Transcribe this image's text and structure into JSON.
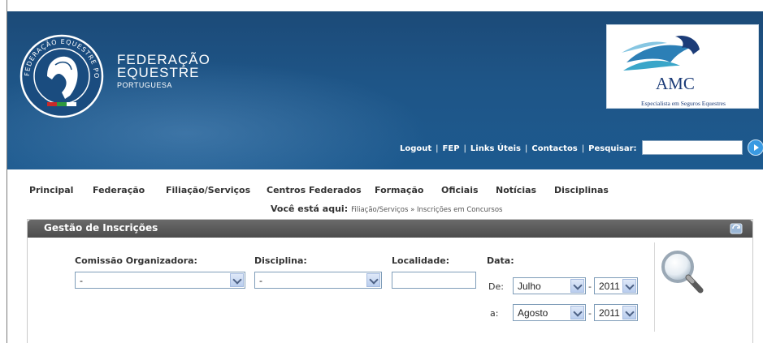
{
  "header": {
    "logo_line1": "FEDERAÇÃO",
    "logo_line2": "EQUESTRE",
    "logo_line3": "PORTUGUESA",
    "seal_text": "FEDERAÇÃO EQUESTRE PORTUGUESA",
    "sponsor_name": "AMC",
    "sponsor_tagline": "Especialista em Seguros Equestres",
    "top_links": [
      "Logout",
      "FEP",
      "Links Úteis",
      "Contactos"
    ],
    "search_label": "Pesquisar:",
    "search_value": ""
  },
  "nav": {
    "items": [
      "Principal",
      "Federação",
      "Filiação/Serviços",
      "Centros Federados",
      "Formação",
      "Oficiais",
      "Notícias",
      "Disciplinas"
    ]
  },
  "breadcrumb": {
    "label": "Você está aqui:",
    "path": "Filiação/Serviços » Inscrições em Concursos"
  },
  "panel": {
    "title": "Gestão de Inscrições",
    "fields": {
      "comissao_label": "Comissão Organizadora:",
      "comissao_value": "-",
      "disciplina_label": "Disciplina:",
      "disciplina_value": "-",
      "localidade_label": "Localidade:",
      "localidade_value": "",
      "data_label": "Data:",
      "de_label": "De:",
      "de_month": "Julho",
      "de_year": "2011",
      "a_label": "a:",
      "a_month": "Agosto",
      "a_year": "2011",
      "dash": "-"
    }
  },
  "colors": {
    "header_blue": "#1e5587",
    "panel_header": "#555555",
    "accent_button": "#3a9ae2"
  }
}
